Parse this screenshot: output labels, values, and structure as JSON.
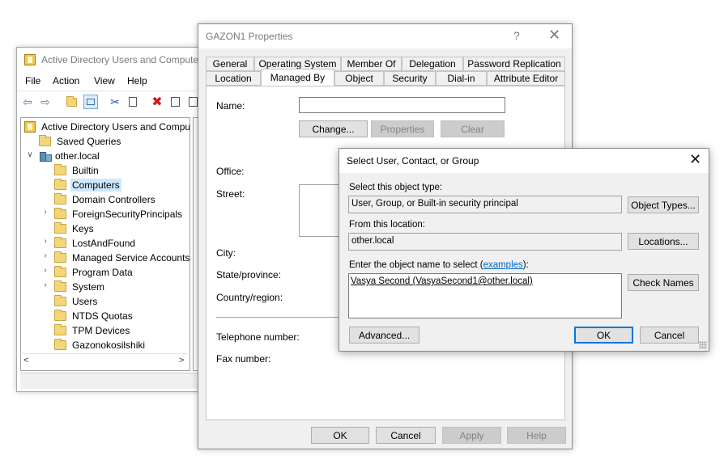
{
  "aduc": {
    "title": "Active Directory Users and Computers",
    "menu": [
      "File",
      "Action",
      "View",
      "Help"
    ],
    "tree": {
      "root": "Active Directory Users and Computers",
      "saved_queries": "Saved Queries",
      "domain": "other.local",
      "children": [
        "Builtin",
        "Computers",
        "Domain Controllers",
        "ForeignSecurityPrincipals",
        "Keys",
        "LostAndFound",
        "Managed Service Accounts",
        "Program Data",
        "System",
        "Users",
        "NTDS Quotas",
        "TPM Devices",
        "Gazonokosilshiki"
      ],
      "selected": "Computers"
    },
    "scroll_left": "<",
    "scroll_right": ">"
  },
  "props": {
    "title": "GAZON1 Properties",
    "help_glyph": "?",
    "close_glyph": "✕",
    "tabs_row1": [
      "General",
      "Operating System",
      "Member Of",
      "Delegation",
      "Password Replication"
    ],
    "tabs_row2": [
      "Location",
      "Managed By",
      "Object",
      "Security",
      "Dial-in",
      "Attribute Editor"
    ],
    "active_tab": "Managed By",
    "name_label": "Name:",
    "change_button": "Change...",
    "properties_button": "Properties",
    "clear_button": "Clear",
    "office_label": "Office:",
    "street_label": "Street:",
    "city_label": "City:",
    "state_label": "State/province:",
    "country_label": "Country/region:",
    "telephone_label": "Telephone number:",
    "fax_label": "Fax number:",
    "ok_button": "OK",
    "cancel_button": "Cancel",
    "apply_button": "Apply",
    "help_button": "Help"
  },
  "select": {
    "title": "Select User, Contact, or Group",
    "close_glyph": "✕",
    "object_type_label": "Select this object type:",
    "object_type_value": "User, Group, or Built-in security principal",
    "object_types_button": "Object Types...",
    "location_label": "From this location:",
    "location_value": "other.local",
    "locations_button": "Locations...",
    "enter_label_prefix": "Enter the object name to select (",
    "enter_label_link": "examples",
    "enter_label_suffix": "):",
    "object_name_value": "Vasya Second (VasyaSecond1@other.local)",
    "check_names_button": "Check Names",
    "advanced_button": "Advanced...",
    "ok_button": "OK",
    "cancel_button": "Cancel"
  }
}
